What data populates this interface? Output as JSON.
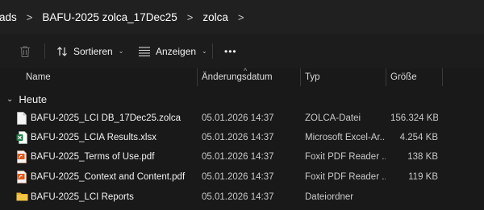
{
  "breadcrumb": {
    "items": [
      "ads",
      "BAFU-2025 zolca_17Dec25",
      "zolca"
    ],
    "separator": ">"
  },
  "toolbar": {
    "sort_label": "Sortieren",
    "view_label": "Anzeigen",
    "more_label": "•••",
    "chevron": "⌄"
  },
  "columns": {
    "name": "Name",
    "date": "Änderungsdatum",
    "type": "Typ",
    "size": "Größe",
    "sort_indicator": "^"
  },
  "group": {
    "label": "Heute",
    "chevron": "⌄"
  },
  "files": [
    {
      "name": "BAFU-2025_LCI DB_17Dec25.zolca",
      "date": "05.01.2026 14:37",
      "type": "ZOLCA-Datei",
      "size": "156.324 KB",
      "icon": "generic-file-icon"
    },
    {
      "name": "BAFU-2025_LCIA Results.xlsx",
      "date": "05.01.2026 14:37",
      "type": "Microsoft Excel-Ar...",
      "size": "4.254 KB",
      "icon": "excel-file-icon"
    },
    {
      "name": "BAFU-2025_Terms of Use.pdf",
      "date": "05.01.2026 14:37",
      "type": "Foxit PDF Reader ...",
      "size": "138 KB",
      "icon": "pdf-file-icon"
    },
    {
      "name": "BAFU-2025_Context and Content.pdf",
      "date": "05.01.2026 14:37",
      "type": "Foxit PDF Reader ...",
      "size": "119 KB",
      "icon": "pdf-file-icon"
    },
    {
      "name": "BAFU-2025_LCI Reports",
      "date": "05.01.2026 14:37",
      "type": "Dateiordner",
      "size": "",
      "icon": "folder-icon"
    }
  ],
  "colors": {
    "background": "#191919",
    "excel_green": "#1d7a45",
    "pdf_orange": "#e0571b",
    "folder_yellow": "#f4c545"
  }
}
